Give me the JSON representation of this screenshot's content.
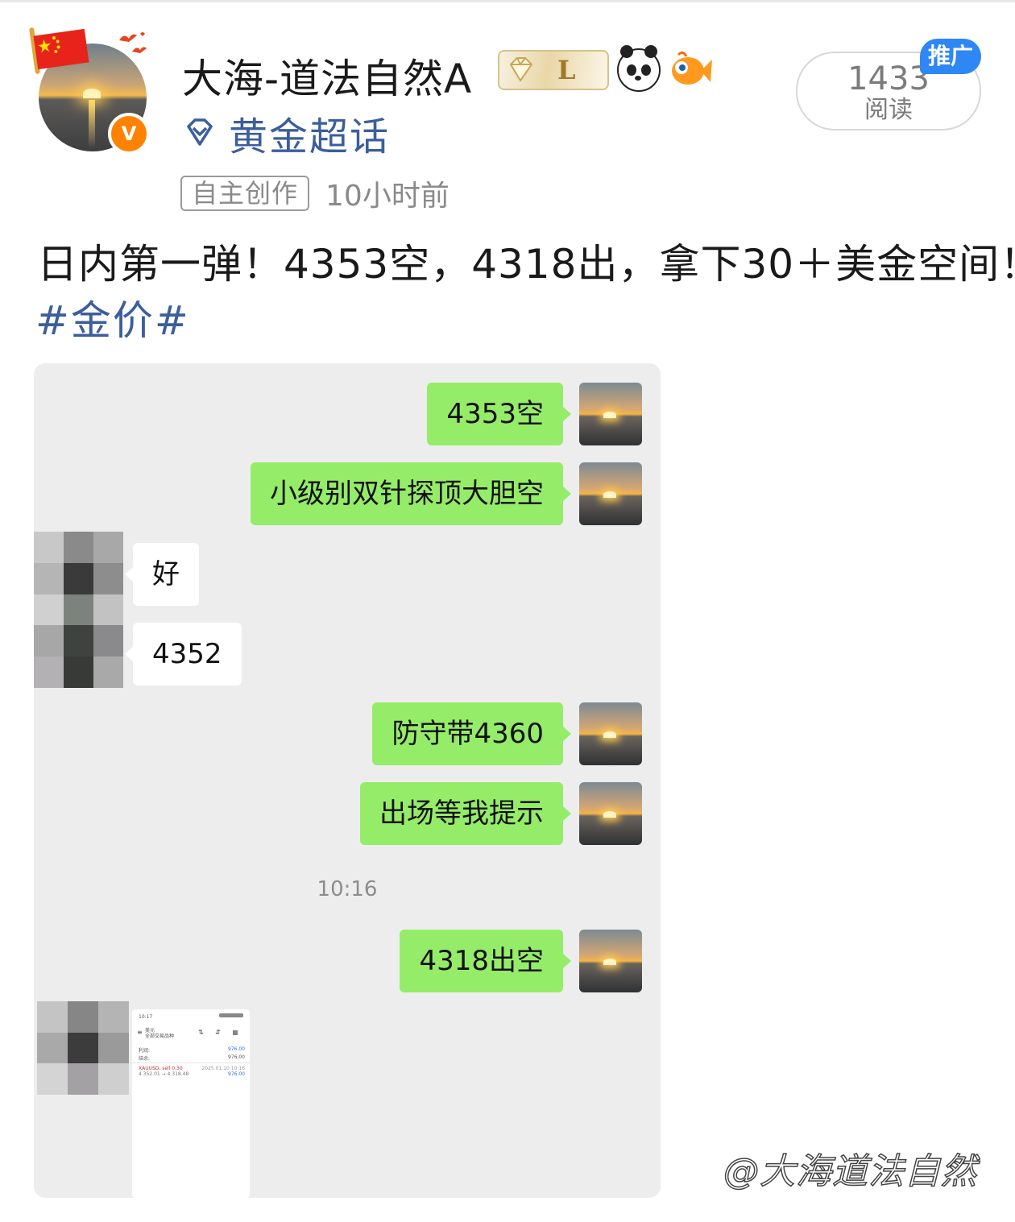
{
  "post": {
    "username": "大海-道法自然A",
    "topic": "黄金超话",
    "tag": "自主创作",
    "time": "10小时前",
    "reads_count": "1433",
    "reads_label": "阅读",
    "promo_label": "推广",
    "text": "日内第一弹！4353空，4318出，拿下30＋美金空间！",
    "hashtag": "#金价#",
    "badge_letter": "L",
    "verified_mark": "V"
  },
  "chat": {
    "messages": [
      {
        "from": "me",
        "text": "4353空"
      },
      {
        "from": "me",
        "text": "小级别双针探顶大胆空"
      },
      {
        "from": "other",
        "text": "好"
      },
      {
        "from": "other",
        "text": "4352"
      },
      {
        "from": "me",
        "text": "防守带4360"
      },
      {
        "from": "me",
        "text": "出场等我提示"
      },
      {
        "from": "me",
        "text": "4318出空"
      }
    ],
    "timestamp": "10:16",
    "screenshot": {
      "status_time": "10:17",
      "tab_label": "美元",
      "title": "全部交易品种",
      "row1_label": "利润:",
      "row1_value": "976.00",
      "row2_label": "结余:",
      "row2_value": "976.00",
      "trade_symbol": "XAUUSD, sell 0.30",
      "trade_prices": "4 352.01 → 4 318.48",
      "trade_date": "2025.01.10 10:16",
      "trade_profit": "976.00"
    }
  },
  "watermark": "@大海道法自然",
  "colors": {
    "link_blue": "#3b5e9c",
    "bubble_green": "#95ec69",
    "promo_blue": "#2e87f5",
    "verified_orange": "#ff8200"
  }
}
